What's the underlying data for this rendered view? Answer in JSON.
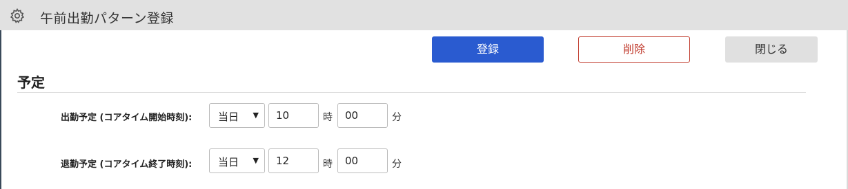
{
  "window": {
    "title": "午前出勤パターン登録",
    "icon": "gear-icon"
  },
  "toolbar": {
    "register_label": "登録",
    "delete_label": "削除",
    "close_label": "閉じる"
  },
  "section": {
    "title": "予定"
  },
  "rows": [
    {
      "label": "出勤予定 (コアタイム開始時刻):",
      "day": "当日",
      "hour": "10",
      "hour_unit": "時",
      "minute": "00",
      "minute_unit": "分"
    },
    {
      "label": "退勤予定 (コアタイム終了時刻):",
      "day": "当日",
      "hour": "12",
      "hour_unit": "時",
      "minute": "00",
      "minute_unit": "分"
    }
  ],
  "colors": {
    "primary": "#2a5bd0",
    "danger": "#c0392b",
    "titlebar": "#e1e1e1"
  }
}
